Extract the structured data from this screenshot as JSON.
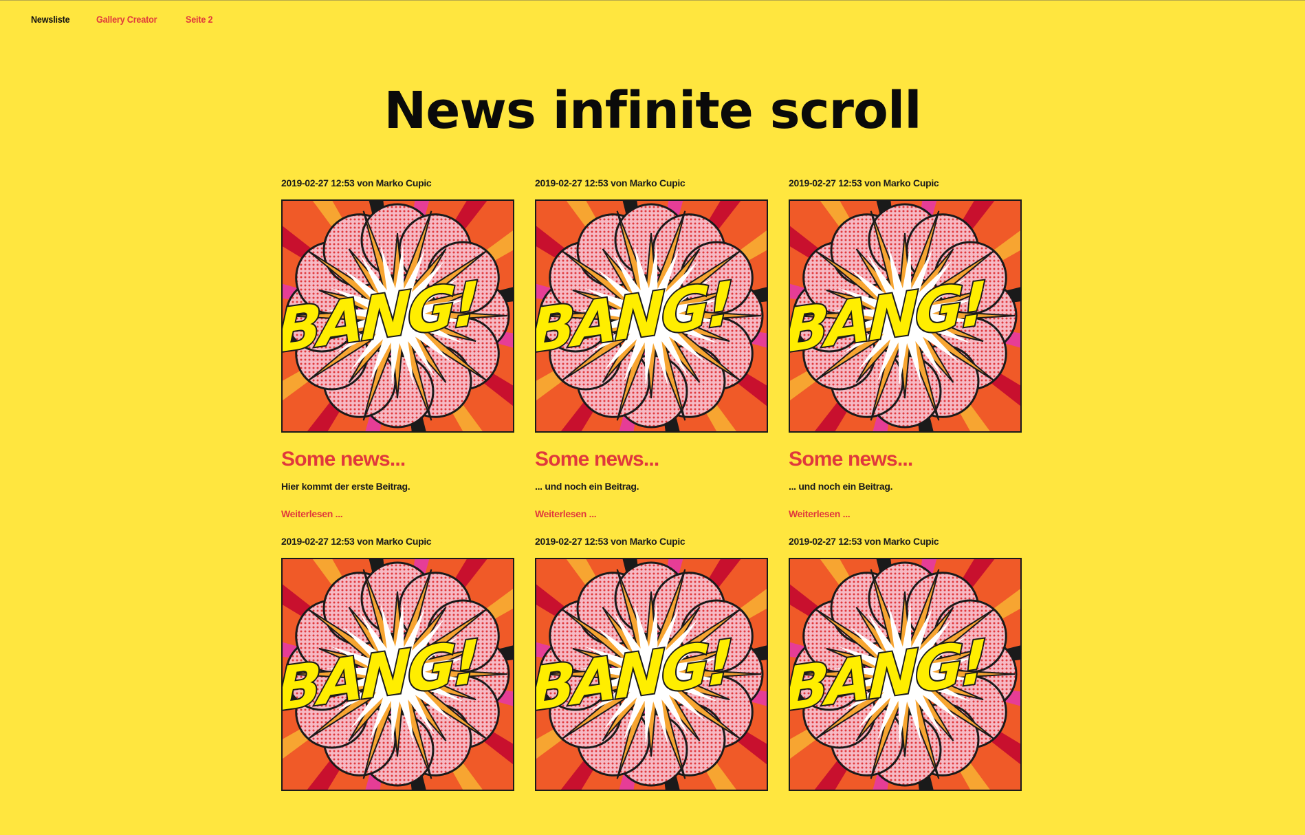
{
  "nav": {
    "items": [
      {
        "label": "Newsliste",
        "active": true
      },
      {
        "label": "Gallery Creator",
        "active": false
      },
      {
        "label": "Seite 2",
        "active": false
      }
    ]
  },
  "page": {
    "title": "News infinite scroll"
  },
  "image_text": "BANG!",
  "colors": {
    "background": "#ffe63f",
    "accent": "#e0393c"
  },
  "news": [
    {
      "meta": "2019-02-27 12:53 von Marko Cupic",
      "headline": "Some news...",
      "teaser": "Hier kommt der erste Beitrag.",
      "more": "Weiterlesen ..."
    },
    {
      "meta": "2019-02-27 12:53 von Marko Cupic",
      "headline": "Some news...",
      "teaser": "... und noch ein Beitrag.",
      "more": "Weiterlesen ..."
    },
    {
      "meta": "2019-02-27 12:53 von Marko Cupic",
      "headline": "Some news...",
      "teaser": "... und noch ein Beitrag.",
      "more": "Weiterlesen ..."
    },
    {
      "meta": "2019-02-27 12:53 von Marko Cupic",
      "headline": "",
      "teaser": "",
      "more": ""
    },
    {
      "meta": "2019-02-27 12:53 von Marko Cupic",
      "headline": "",
      "teaser": "",
      "more": ""
    },
    {
      "meta": "2019-02-27 12:53 von Marko Cupic",
      "headline": "",
      "teaser": "",
      "more": ""
    }
  ]
}
